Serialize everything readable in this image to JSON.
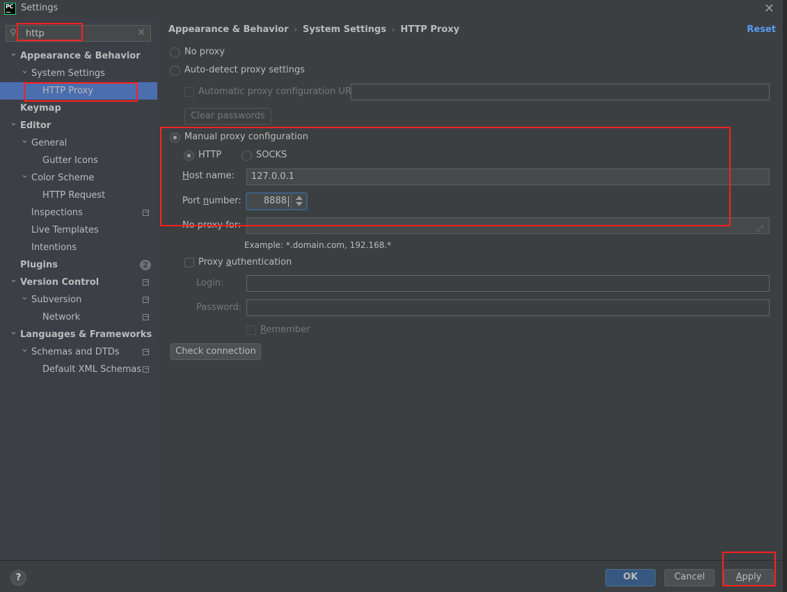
{
  "window": {
    "title": "Settings",
    "logo": "PC",
    "close_icon": "close-icon"
  },
  "search": {
    "value": "http",
    "placeholder": ""
  },
  "sidebar": {
    "items": [
      {
        "label": "Appearance & Behavior",
        "level": 0,
        "bold": true,
        "expanded": true
      },
      {
        "label": "System Settings",
        "level": 1,
        "expanded": true
      },
      {
        "label": "HTTP Proxy",
        "level": 2,
        "selected": true
      },
      {
        "label": "Keymap",
        "level": 0,
        "bold": true
      },
      {
        "label": "Editor",
        "level": 0,
        "bold": true,
        "expanded": true
      },
      {
        "label": "General",
        "level": 1,
        "expanded": true
      },
      {
        "label": "Gutter Icons",
        "level": 2
      },
      {
        "label": "Color Scheme",
        "level": 1,
        "expanded": true
      },
      {
        "label": "HTTP Request",
        "level": 2
      },
      {
        "label": "Inspections",
        "level": 1,
        "project_icon": true
      },
      {
        "label": "Live Templates",
        "level": 1
      },
      {
        "label": "Intentions",
        "level": 1
      },
      {
        "label": "Plugins",
        "level": 0,
        "bold": true,
        "badge": "2"
      },
      {
        "label": "Version Control",
        "level": 0,
        "bold": true,
        "expanded": true,
        "project_icon": true
      },
      {
        "label": "Subversion",
        "level": 1,
        "expanded": true,
        "project_icon": true
      },
      {
        "label": "Network",
        "level": 2,
        "project_icon": true
      },
      {
        "label": "Languages & Frameworks",
        "level": 0,
        "bold": true,
        "expanded": true
      },
      {
        "label": "Schemas and DTDs",
        "level": 1,
        "expanded": true,
        "project_icon": true
      },
      {
        "label": "Default XML Schemas",
        "level": 2,
        "project_icon": true
      }
    ]
  },
  "breadcrumb": [
    "Appearance & Behavior",
    "System Settings",
    "HTTP Proxy"
  ],
  "reset_label": "Reset",
  "proxy": {
    "no_proxy_label": "No proxy",
    "auto_detect_label": "Auto-detect proxy settings",
    "auto_config_url_label": "Automatic proxy configuration URL:",
    "auto_config_url_value": "",
    "clear_passwords_label": "Clear passwords",
    "manual_label": "Manual proxy configuration",
    "selected_mode": "manual",
    "http_label": "HTTP",
    "socks_label": "SOCKS",
    "selected_type": "HTTP",
    "host_label_u": "H",
    "host_label_rest": "ost name:",
    "host_value": "127.0.0.1",
    "port_label_pre": "Port ",
    "port_label_u": "n",
    "port_label_rest": "umber:",
    "port_value": "8888",
    "no_proxy_for_label": "No proxy for:",
    "no_proxy_for_value": "",
    "example_text": "Example: *.domain.com, 192.168.*",
    "auth_label_pre": "Proxy ",
    "auth_label_u": "a",
    "auth_label_rest": "uthentication",
    "auth_checked": false,
    "login_label": "Login:",
    "login_value": "",
    "password_label": "Password:",
    "password_value": "",
    "remember_u": "R",
    "remember_rest": "emember",
    "check_connection_label": "Check connection"
  },
  "footer": {
    "help_label": "?",
    "ok_label": "OK",
    "cancel_label": "Cancel",
    "apply_u": "A",
    "apply_rest": "pply"
  },
  "colors": {
    "accent": "#4b6eaf",
    "link": "#589df6",
    "primary_button": "#365880",
    "annotation": "#ff2020"
  }
}
